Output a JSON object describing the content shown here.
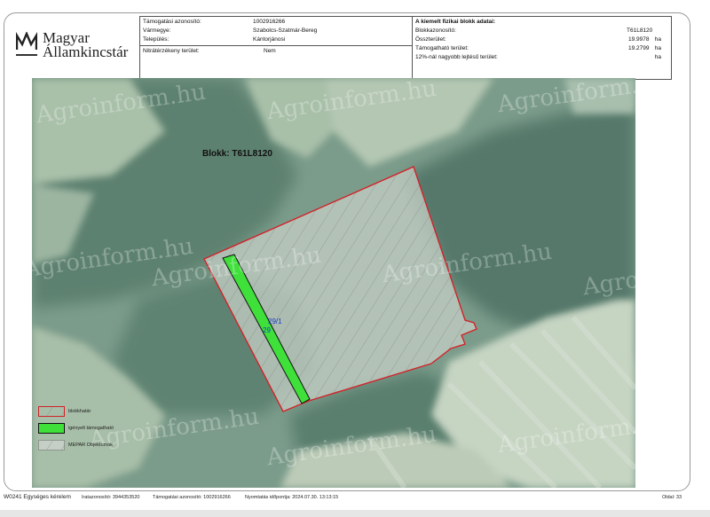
{
  "logo": {
    "line1": "Magyar",
    "line2": "Államkincstár"
  },
  "header": {
    "support_id_label": "Támogatási azonosító:",
    "support_id_value": "1002916266",
    "county_label": "Vármegye:",
    "county_value": "Szabolcs-Szatmár-Bereg",
    "settlement_label": "Település:",
    "settlement_value": "Kántorjánosi",
    "nitrate_label": "Nitrátérzékeny terület:",
    "nitrate_value": "Nem",
    "block_title": "A kiemelt fizikai blokk adatai:",
    "block_id_label": "Blokkazonosító:",
    "block_id_value": "T61L8120",
    "total_area_label": "Összterület:",
    "total_area_value": "19.9978",
    "total_area_unit": "ha",
    "supportable_label": "Támogatható terület:",
    "supportable_value": "19.2799",
    "supportable_unit": "ha",
    "slope_label": "12%-nál nagyobb lejtésű terület:",
    "slope_value": "",
    "slope_unit": "ha"
  },
  "map": {
    "block_label": "Blokk: T61L8120",
    "parcel_label_1": "29/1",
    "parcel_label_2": "29",
    "watermark_text": "Agroinform.hu",
    "colors": {
      "block_border": "#d2232a",
      "claimed_fill": "#3fe03a",
      "hatch": "#8f8f8f"
    }
  },
  "legend": {
    "item1": "blokkhatár",
    "item2": "igényelt támogatható",
    "item3": "MEPAR Objektumok"
  },
  "footer": {
    "form_title": "W0241 Egységes kérelem",
    "case_id": "Iratazonosító: 3944353520",
    "support_id": "Támogatási azonosító: 1002916266",
    "print_time": "Nyomtatás időpontja: 2024.07.30. 13:13:15",
    "page": "Oldal: 33"
  }
}
